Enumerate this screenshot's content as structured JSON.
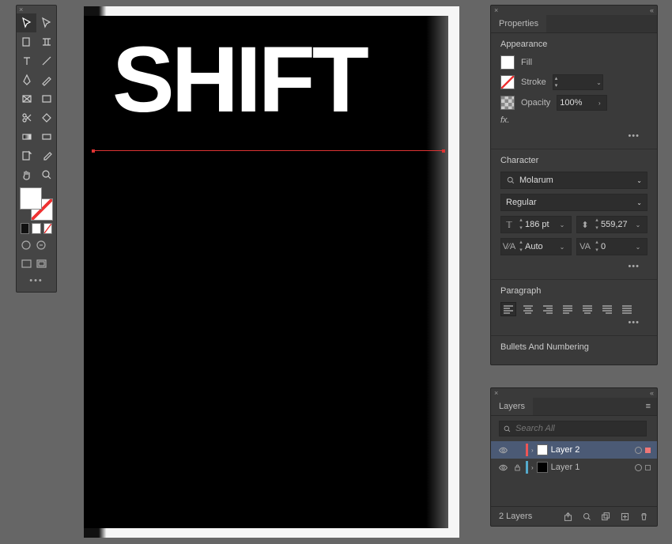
{
  "toolbox": {
    "tools": [
      "selection",
      "direct-selection",
      "page",
      "gap",
      "type",
      "line",
      "pen",
      "pencil",
      "rectangle",
      "frame",
      "scissors",
      "transform",
      "gradient",
      "note",
      "eyedropper-color",
      "measure",
      "hand",
      "zoom"
    ]
  },
  "canvas": {
    "text": "SHIFT"
  },
  "properties": {
    "tab": "Properties",
    "appearance": {
      "title": "Appearance",
      "fill_label": "Fill",
      "stroke_label": "Stroke",
      "stroke_value": "",
      "opacity_label": "Opacity",
      "opacity_value": "100%",
      "fx_label": "fx."
    },
    "character": {
      "title": "Character",
      "font_family": "Molarum",
      "font_style": "Regular",
      "font_size": "186 pt",
      "leading": "559,27",
      "kerning": "Auto",
      "tracking": "0"
    },
    "paragraph": {
      "title": "Paragraph"
    },
    "bullets": {
      "title": "Bullets And Numbering"
    }
  },
  "layers": {
    "tab": "Layers",
    "search_placeholder": "Search All",
    "items": [
      {
        "name": "Layer 2",
        "color": "red",
        "thumb": "white",
        "locked": false,
        "selected": true
      },
      {
        "name": "Layer 1",
        "color": "blue",
        "thumb": "black",
        "locked": true,
        "selected": false
      }
    ],
    "footer_count": "2 Layers"
  }
}
